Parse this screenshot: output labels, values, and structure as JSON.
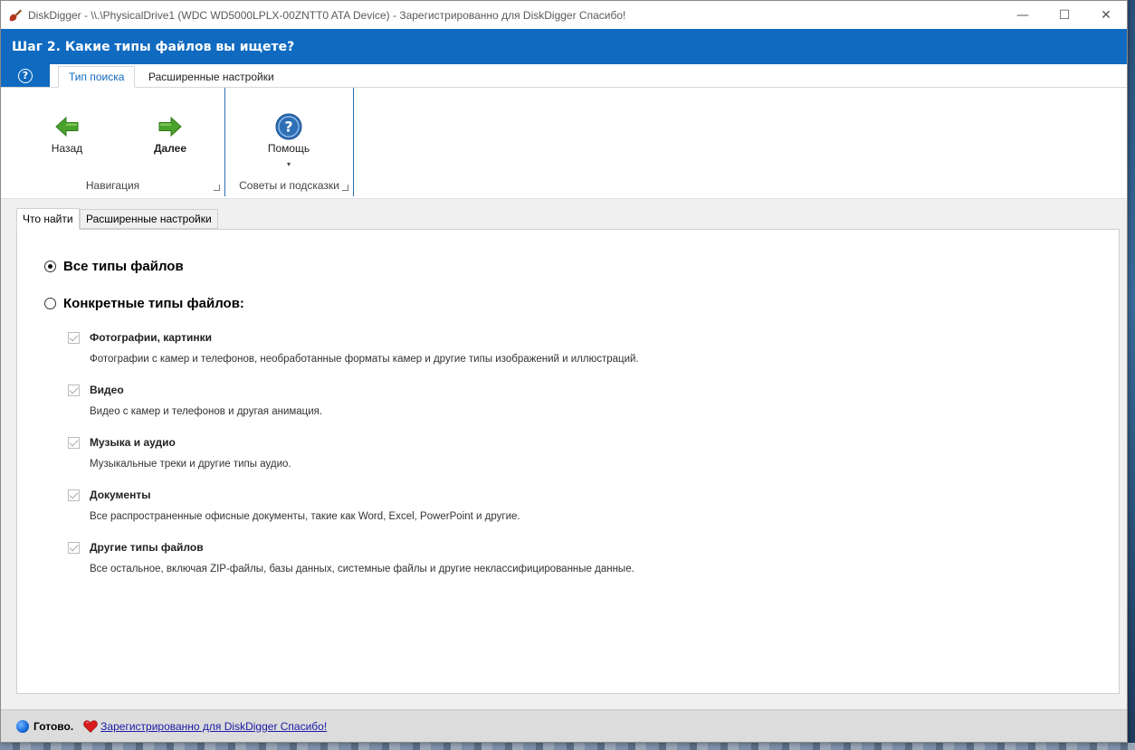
{
  "window": {
    "title": "DiskDigger - \\\\.\\PhysicalDrive1 (WDC WD5000LPLX-00ZNTT0 ATA Device) - Зарегистрированно для DiskDigger  Спасибо!",
    "minimize": "—",
    "maximize": "☐",
    "close": "✕"
  },
  "header": {
    "title": "Шаг 2. Какие типы файлов вы ищете?"
  },
  "ribbon": {
    "help_glyph": "?",
    "tabs": [
      "Тип поиска",
      "Расширенные настройки"
    ],
    "groups": {
      "navigation": {
        "label": "Навигация",
        "back_label": "Назад",
        "next_label": "Далее"
      },
      "tips": {
        "label": "Советы и подсказки",
        "help_label": "Помощь",
        "dropdown_glyph": "▾"
      }
    }
  },
  "inner_tabs": [
    "Что найти",
    "Расширенные настройки"
  ],
  "options": {
    "all_types": {
      "label": "Все типы файлов",
      "checked": true
    },
    "specific_types": {
      "label": "Конкретные типы файлов:",
      "checked": false
    }
  },
  "file_types": [
    {
      "label": "Фотографии, картинки",
      "desc": "Фотографии с камер и телефонов, необработанные форматы камер и другие типы изображений и иллюстраций.",
      "checked": true
    },
    {
      "label": "Видео",
      "desc": "Видео с камер и телефонов и другая анимация.",
      "checked": true
    },
    {
      "label": "Музыка и аудио",
      "desc": "Музыкальные треки и другие типы аудио.",
      "checked": true
    },
    {
      "label": "Документы",
      "desc": "Все распространенные офисные документы, такие как Word, Excel, PowerPoint и другие.",
      "checked": true
    },
    {
      "label": "Другие типы файлов",
      "desc": "Все остальное, включая ZIP-файлы, базы данных, системные файлы и другие неклассифицированные данные.",
      "checked": true
    }
  ],
  "status": {
    "text": "Готово.",
    "link": "Зарегистрированно для DiskDigger  Спасибо!"
  },
  "colors": {
    "accent": "#0f6ac0",
    "arrow_green": "#4aa12c",
    "help_blue": "#2f6fb5"
  }
}
